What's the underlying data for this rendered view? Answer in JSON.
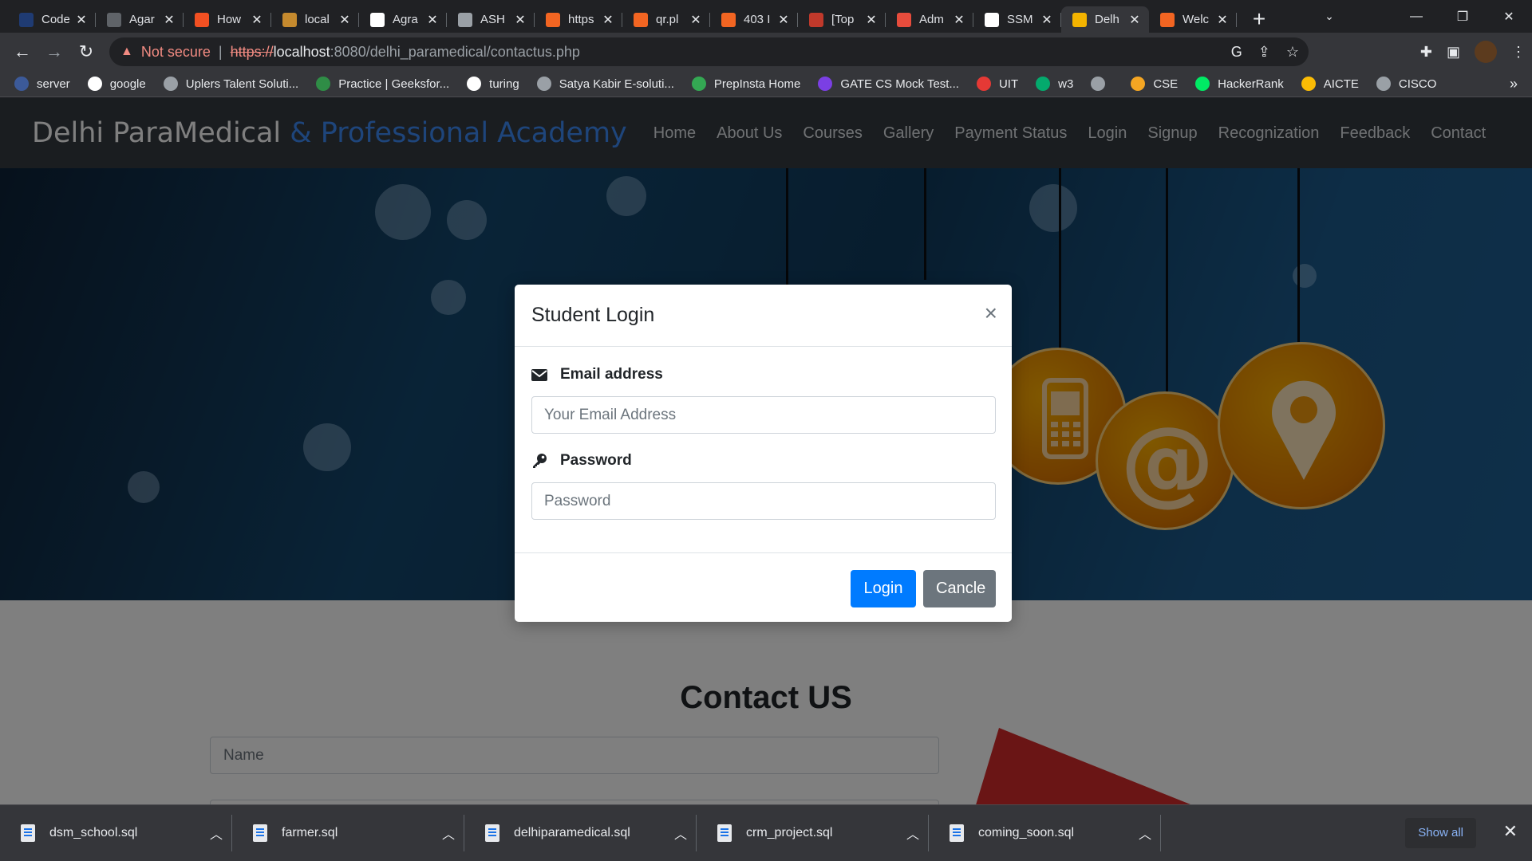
{
  "browser": {
    "tabs": [
      {
        "title": "Code",
        "color": "#1f3b73"
      },
      {
        "title": "Agar",
        "color": "#5f6368"
      },
      {
        "title": "How",
        "color": "#f25022"
      },
      {
        "title": "local",
        "color": "#c58a2e"
      },
      {
        "title": "Agra",
        "color": "#ffffff"
      },
      {
        "title": "ASH",
        "color": "#9aa0a6"
      },
      {
        "title": "https",
        "color": "#f26522"
      },
      {
        "title": "qr.pl",
        "color": "#f26522"
      },
      {
        "title": "403 I",
        "color": "#f26522"
      },
      {
        "title": "[Top",
        "color": "#c0392b"
      },
      {
        "title": "Adm",
        "color": "#e74c3c"
      },
      {
        "title": "SSM",
        "color": "#ffffff"
      },
      {
        "title": "Delh",
        "color": "#f4b400",
        "active": true
      },
      {
        "title": "Welc",
        "color": "#f26522"
      }
    ],
    "new_tab": "+",
    "address": {
      "not_secure": "Not secure",
      "scheme": "https://",
      "host": "localhost",
      "rest": ":8080/delhi_paramedical/contactus.php"
    },
    "bookmarks": [
      {
        "label": "server",
        "color": "#3c5a99"
      },
      {
        "label": "google",
        "color": "#ffffff"
      },
      {
        "label": "Uplers Talent Soluti...",
        "color": "#9aa0a6"
      },
      {
        "label": "Practice | Geeksfor...",
        "color": "#2f8d46"
      },
      {
        "label": "turing",
        "color": "#ffffff"
      },
      {
        "label": "Satya Kabir E-soluti...",
        "color": "#9aa0a6"
      },
      {
        "label": "PrepInsta Home",
        "color": "#34a853"
      },
      {
        "label": "GATE CS Mock Test...",
        "color": "#7b3fe4"
      },
      {
        "label": "UIT",
        "color": "#e53935"
      },
      {
        "label": "w3",
        "color": "#04aa6d"
      },
      {
        "label": "",
        "color": "#9aa0a6"
      },
      {
        "label": "CSE",
        "color": "#f5a623"
      },
      {
        "label": "HackerRank",
        "color": "#00ea64"
      },
      {
        "label": "AICTE",
        "color": "#fbbc05"
      },
      {
        "label": "CISCO",
        "color": "#9aa0a6"
      }
    ],
    "bookmarks_more": "»"
  },
  "site": {
    "brand_main": "Delhi ParaMedical",
    "brand_accent": "& Professional Academy",
    "menu": [
      "Home",
      "About Us",
      "Courses",
      "Gallery",
      "Payment Status",
      "Login",
      "Signup",
      "Recognization",
      "Feedback",
      "Contact"
    ],
    "contact_heading": "Contact US",
    "name_placeholder": "Name"
  },
  "modal": {
    "title": "Student Login",
    "close": "×",
    "email_label": "Email address",
    "email_placeholder": "Your Email Address",
    "email_value": "",
    "password_label": "Password",
    "password_placeholder": "Password",
    "password_value": "",
    "login_button": "Login",
    "cancel_button": "Cancle"
  },
  "downloads": {
    "items": [
      "dsm_school.sql",
      "farmer.sql",
      "delhiparamedical.sql",
      "crm_project.sql",
      "coming_soon.sql"
    ],
    "show_all": "Show all",
    "close": "✕"
  },
  "icons": {
    "envelope": "envelope-icon",
    "key": "key-icon",
    "mobile": "mobile-phone-icon",
    "at": "at-sign-icon",
    "pin": "location-pin-icon"
  }
}
